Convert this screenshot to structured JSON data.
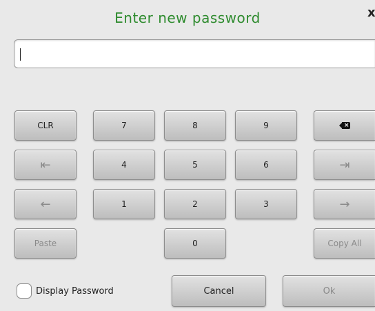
{
  "dialog": {
    "title": "Enter new password",
    "close_glyph": "x"
  },
  "password_input": {
    "value": ""
  },
  "keypad": {
    "clear": "CLR",
    "backspace_icon": "backspace-icon",
    "digits": {
      "d7": "7",
      "d8": "8",
      "d9": "9",
      "d4": "4",
      "d5": "5",
      "d6": "6",
      "d1": "1",
      "d2": "2",
      "d3": "3",
      "d0": "0"
    },
    "home_glyph": "⇤",
    "end_glyph": "⇥",
    "left_glyph": "←",
    "right_glyph": "→",
    "paste": "Paste",
    "copy_all": "Copy All"
  },
  "footer": {
    "display_password_label": "Display Password",
    "display_password_checked": false,
    "cancel": "Cancel",
    "ok": "Ok"
  },
  "colors": {
    "title": "#2e8b2e",
    "background": "#e9e9e9",
    "disabled_text": "#8a8a8a"
  }
}
